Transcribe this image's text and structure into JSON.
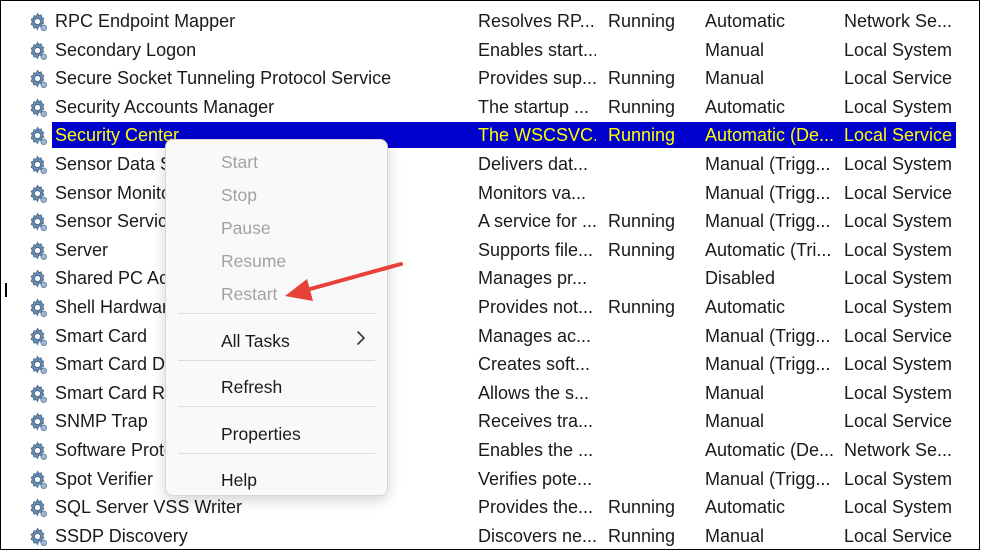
{
  "services": [
    {
      "name": "RPC Endpoint Mapper",
      "description": "Resolves RP...",
      "status": "Running",
      "startup": "Automatic",
      "logon": "Network Se..."
    },
    {
      "name": "Secondary Logon",
      "description": "Enables start...",
      "status": "",
      "startup": "Manual",
      "logon": "Local System"
    },
    {
      "name": "Secure Socket Tunneling Protocol Service",
      "description": "Provides sup...",
      "status": "Running",
      "startup": "Manual",
      "logon": "Local Service"
    },
    {
      "name": "Security Accounts Manager",
      "description": "The startup ...",
      "status": "Running",
      "startup": "Automatic",
      "logon": "Local System"
    },
    {
      "name": "Security Center",
      "description": "The WSCSVC...",
      "status": "Running",
      "startup": "Automatic (De...",
      "logon": "Local Service",
      "selected": true
    },
    {
      "name": "Sensor Data Se",
      "description": "Delivers dat...",
      "status": "",
      "startup": "Manual (Trigg...",
      "logon": "Local System"
    },
    {
      "name": "Sensor Monito",
      "description": "Monitors va...",
      "status": "",
      "startup": "Manual (Trigg...",
      "logon": "Local Service"
    },
    {
      "name": "Sensor Service",
      "description": "A service for ...",
      "status": "Running",
      "startup": "Manual (Trigg...",
      "logon": "Local System"
    },
    {
      "name": "Server",
      "description": "Supports file...",
      "status": "Running",
      "startup": "Automatic (Tri...",
      "logon": "Local System"
    },
    {
      "name": "Shared PC Acc",
      "description": "Manages pr...",
      "status": "",
      "startup": "Disabled",
      "logon": "Local System"
    },
    {
      "name": "Shell Hardware",
      "description": "Provides not...",
      "status": "Running",
      "startup": "Automatic",
      "logon": "Local System"
    },
    {
      "name": "Smart Card",
      "description": "Manages ac...",
      "status": "",
      "startup": "Manual (Trigg...",
      "logon": "Local Service"
    },
    {
      "name": "Smart Card De",
      "description": "Creates soft...",
      "status": "",
      "startup": "Manual (Trigg...",
      "logon": "Local System"
    },
    {
      "name": "Smart Card Re",
      "description": "Allows the s...",
      "status": "",
      "startup": "Manual",
      "logon": "Local System"
    },
    {
      "name": "SNMP Trap",
      "description": "Receives tra...",
      "status": "",
      "startup": "Manual",
      "logon": "Local Service"
    },
    {
      "name": "Software Prote",
      "description": "Enables the ...",
      "status": "",
      "startup": "Automatic (De...",
      "logon": "Network Se..."
    },
    {
      "name": "Spot Verifier",
      "description": "Verifies pote...",
      "status": "",
      "startup": "Manual (Trigg...",
      "logon": "Local System"
    },
    {
      "name": "SQL Server VSS Writer",
      "description": "Provides the...",
      "status": "Running",
      "startup": "Automatic",
      "logon": "Local System"
    },
    {
      "name": "SSDP Discovery",
      "description": "Discovers ne...",
      "status": "Running",
      "startup": "Manual",
      "logon": "Local Service"
    }
  ],
  "context_menu": {
    "start": "Start",
    "stop": "Stop",
    "pause": "Pause",
    "resume": "Resume",
    "restart": "Restart",
    "all_tasks": "All Tasks",
    "refresh": "Refresh",
    "properties": "Properties",
    "help": "Help"
  },
  "colors": {
    "selection_bg": "#0000cc",
    "selection_text": "#ffff00",
    "annotation_arrow": "#e8413a",
    "disabled_text": "#a3a3a3"
  },
  "icons": {
    "service": "gear-icon",
    "submenu": "chevron-right-icon",
    "annotation": "red-arrow"
  }
}
